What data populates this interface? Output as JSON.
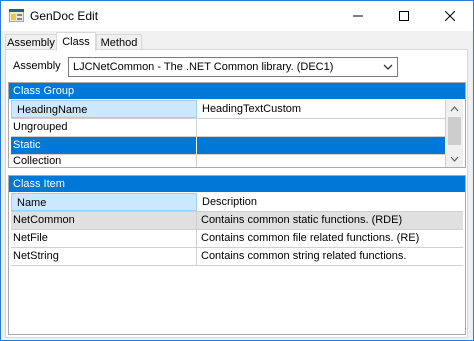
{
  "window": {
    "title": "GenDoc Edit"
  },
  "tabs": [
    {
      "label": "Assembly"
    },
    {
      "label": "Class"
    },
    {
      "label": "Method"
    }
  ],
  "assembly": {
    "label": "Assembly",
    "selected": "LJCNetCommon - The .NET Common library. (DEC1)"
  },
  "class_group": {
    "title": "Class Group",
    "columns": [
      "HeadingName",
      "HeadingTextCustom"
    ],
    "rows": [
      {
        "name": "Ungrouped",
        "text": ""
      },
      {
        "name": "Static",
        "text": ""
      },
      {
        "name": "Collection",
        "text": ""
      }
    ],
    "selected_index": 1
  },
  "class_item": {
    "title": "Class Item",
    "columns": [
      "Name",
      "Description"
    ],
    "rows": [
      {
        "name": "NetCommon",
        "description": "Contains common static functions. (RDE)"
      },
      {
        "name": "NetFile",
        "description": "Contains common file related functions. (RE)"
      },
      {
        "name": "NetString",
        "description": "Contains common string related functions."
      }
    ],
    "highlighted_index": 0
  },
  "colors": {
    "accent": "#0078d7",
    "header_selected": "#cce8ff"
  },
  "icons": [
    "app-icon",
    "minimize-icon",
    "maximize-icon",
    "close-icon",
    "chevron-down-icon",
    "scroll-up-icon",
    "scroll-down-icon"
  ]
}
